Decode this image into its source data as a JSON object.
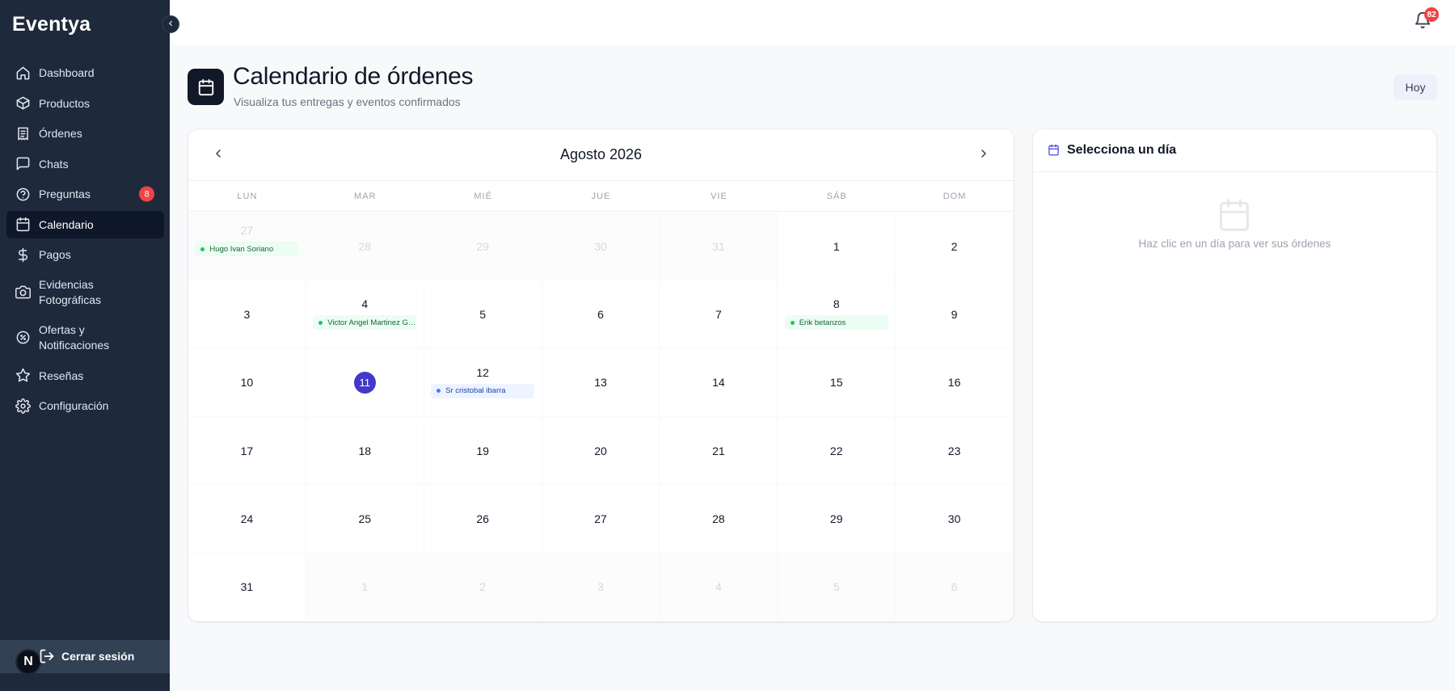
{
  "brand": "Eventya",
  "sidebar": {
    "items": [
      {
        "label": "Dashboard",
        "icon": "home-icon"
      },
      {
        "label": "Productos",
        "icon": "box-icon"
      },
      {
        "label": "Órdenes",
        "icon": "receipt-icon"
      },
      {
        "label": "Chats",
        "icon": "chat-icon"
      },
      {
        "label": "Preguntas",
        "icon": "question-icon",
        "badge": "8"
      },
      {
        "label": "Calendario",
        "icon": "calendar-icon",
        "active": true
      },
      {
        "label": "Pagos",
        "icon": "dollar-icon"
      },
      {
        "label": "Evidencias\nFotográficas",
        "icon": "camera-icon"
      },
      {
        "label": "Ofertas y\nNotificaciones",
        "icon": "offer-icon"
      },
      {
        "label": "Reseñas",
        "icon": "star-icon"
      },
      {
        "label": "Configuración",
        "icon": "gear-icon"
      }
    ],
    "logout_label": "Cerrar sesión",
    "avatar_initial": "N"
  },
  "topbar": {
    "notification_count": "82"
  },
  "page": {
    "title": "Calendario de órdenes",
    "subtitle": "Visualiza tus entregas y eventos confirmados",
    "today_button": "Hoy"
  },
  "calendar": {
    "month_label": "Agosto 2026",
    "weekdays": [
      "LUN",
      "MAR",
      "MIÉ",
      "JUE",
      "VIE",
      "SÁB",
      "DOM"
    ],
    "cells": [
      {
        "day": "27",
        "muted": true,
        "event": {
          "name": "Hugo Ivan Soriano",
          "color": "green"
        }
      },
      {
        "day": "28",
        "muted": true
      },
      {
        "day": "29",
        "muted": true
      },
      {
        "day": "30",
        "muted": true
      },
      {
        "day": "31",
        "muted": true
      },
      {
        "day": "1"
      },
      {
        "day": "2"
      },
      {
        "day": "3"
      },
      {
        "day": "4",
        "event": {
          "name": "Victor Angel Martinez Gomez",
          "color": "green"
        }
      },
      {
        "day": "5"
      },
      {
        "day": "6"
      },
      {
        "day": "7"
      },
      {
        "day": "8",
        "event": {
          "name": "Erik betanzos",
          "color": "green"
        }
      },
      {
        "day": "9"
      },
      {
        "day": "10"
      },
      {
        "day": "11",
        "today": true
      },
      {
        "day": "12",
        "event": {
          "name": "Sr cristobal ibarra",
          "color": "blue"
        }
      },
      {
        "day": "13"
      },
      {
        "day": "14"
      },
      {
        "day": "15"
      },
      {
        "day": "16"
      },
      {
        "day": "17"
      },
      {
        "day": "18"
      },
      {
        "day": "19"
      },
      {
        "day": "20"
      },
      {
        "day": "21"
      },
      {
        "day": "22"
      },
      {
        "day": "23"
      },
      {
        "day": "24"
      },
      {
        "day": "25"
      },
      {
        "day": "26"
      },
      {
        "day": "27"
      },
      {
        "day": "28"
      },
      {
        "day": "29"
      },
      {
        "day": "30"
      },
      {
        "day": "31"
      },
      {
        "day": "1",
        "muted": true
      },
      {
        "day": "2",
        "muted": true
      },
      {
        "day": "3",
        "muted": true
      },
      {
        "day": "4",
        "muted": true
      },
      {
        "day": "5",
        "muted": true
      },
      {
        "day": "6",
        "muted": true
      }
    ]
  },
  "day_panel": {
    "title": "Selecciona un día",
    "empty_text": "Haz clic en un día para ver sus órdenes"
  },
  "colors": {
    "sidebar_bg": "#1e293b",
    "accent": "#4338ca",
    "badge_red": "#ef4444"
  }
}
